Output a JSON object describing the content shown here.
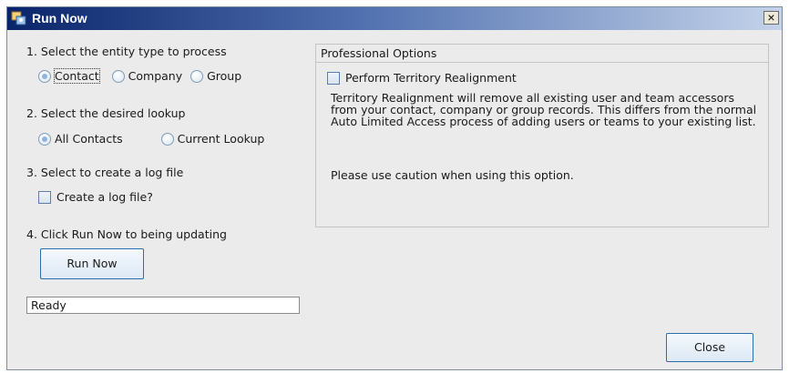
{
  "window": {
    "title": "Run Now",
    "close_glyph": "×"
  },
  "steps": {
    "entity": {
      "label": "1. Select the entity type to process",
      "options": [
        {
          "label": "Contact",
          "selected": true
        },
        {
          "label": "Company",
          "selected": false
        },
        {
          "label": "Group",
          "selected": false
        }
      ]
    },
    "lookup": {
      "label": "2. Select the desired lookup",
      "options": [
        {
          "label": "All Contacts",
          "selected": true
        },
        {
          "label": "Current Lookup",
          "selected": false
        }
      ]
    },
    "logfile": {
      "label": "3. Select to create a log file",
      "checkbox_label": "Create a log file?",
      "checked": false
    },
    "run": {
      "label": "4. Click Run Now to being updating",
      "button_label": "Run Now"
    }
  },
  "status": {
    "value": "Ready"
  },
  "professional_options": {
    "title": "Professional Options",
    "checkbox_label": "Perform Territory Realignment",
    "checked": false,
    "description": "Territory Realignment will remove all existing user and team accessors from your contact, company or group records.  This differs from the normal Auto Limited Access process of adding users or teams to your existing list.",
    "caution": "Please use caution when using this option."
  },
  "footer": {
    "close_label": "Close"
  },
  "icons": {
    "app": "app-icon",
    "close": "close-icon"
  },
  "colors": {
    "titlebar_dark": "#0a246a",
    "titlebar_light": "#c4d3ea",
    "button_border": "#2a6fb0",
    "dialog_background": "#ebebeb"
  }
}
